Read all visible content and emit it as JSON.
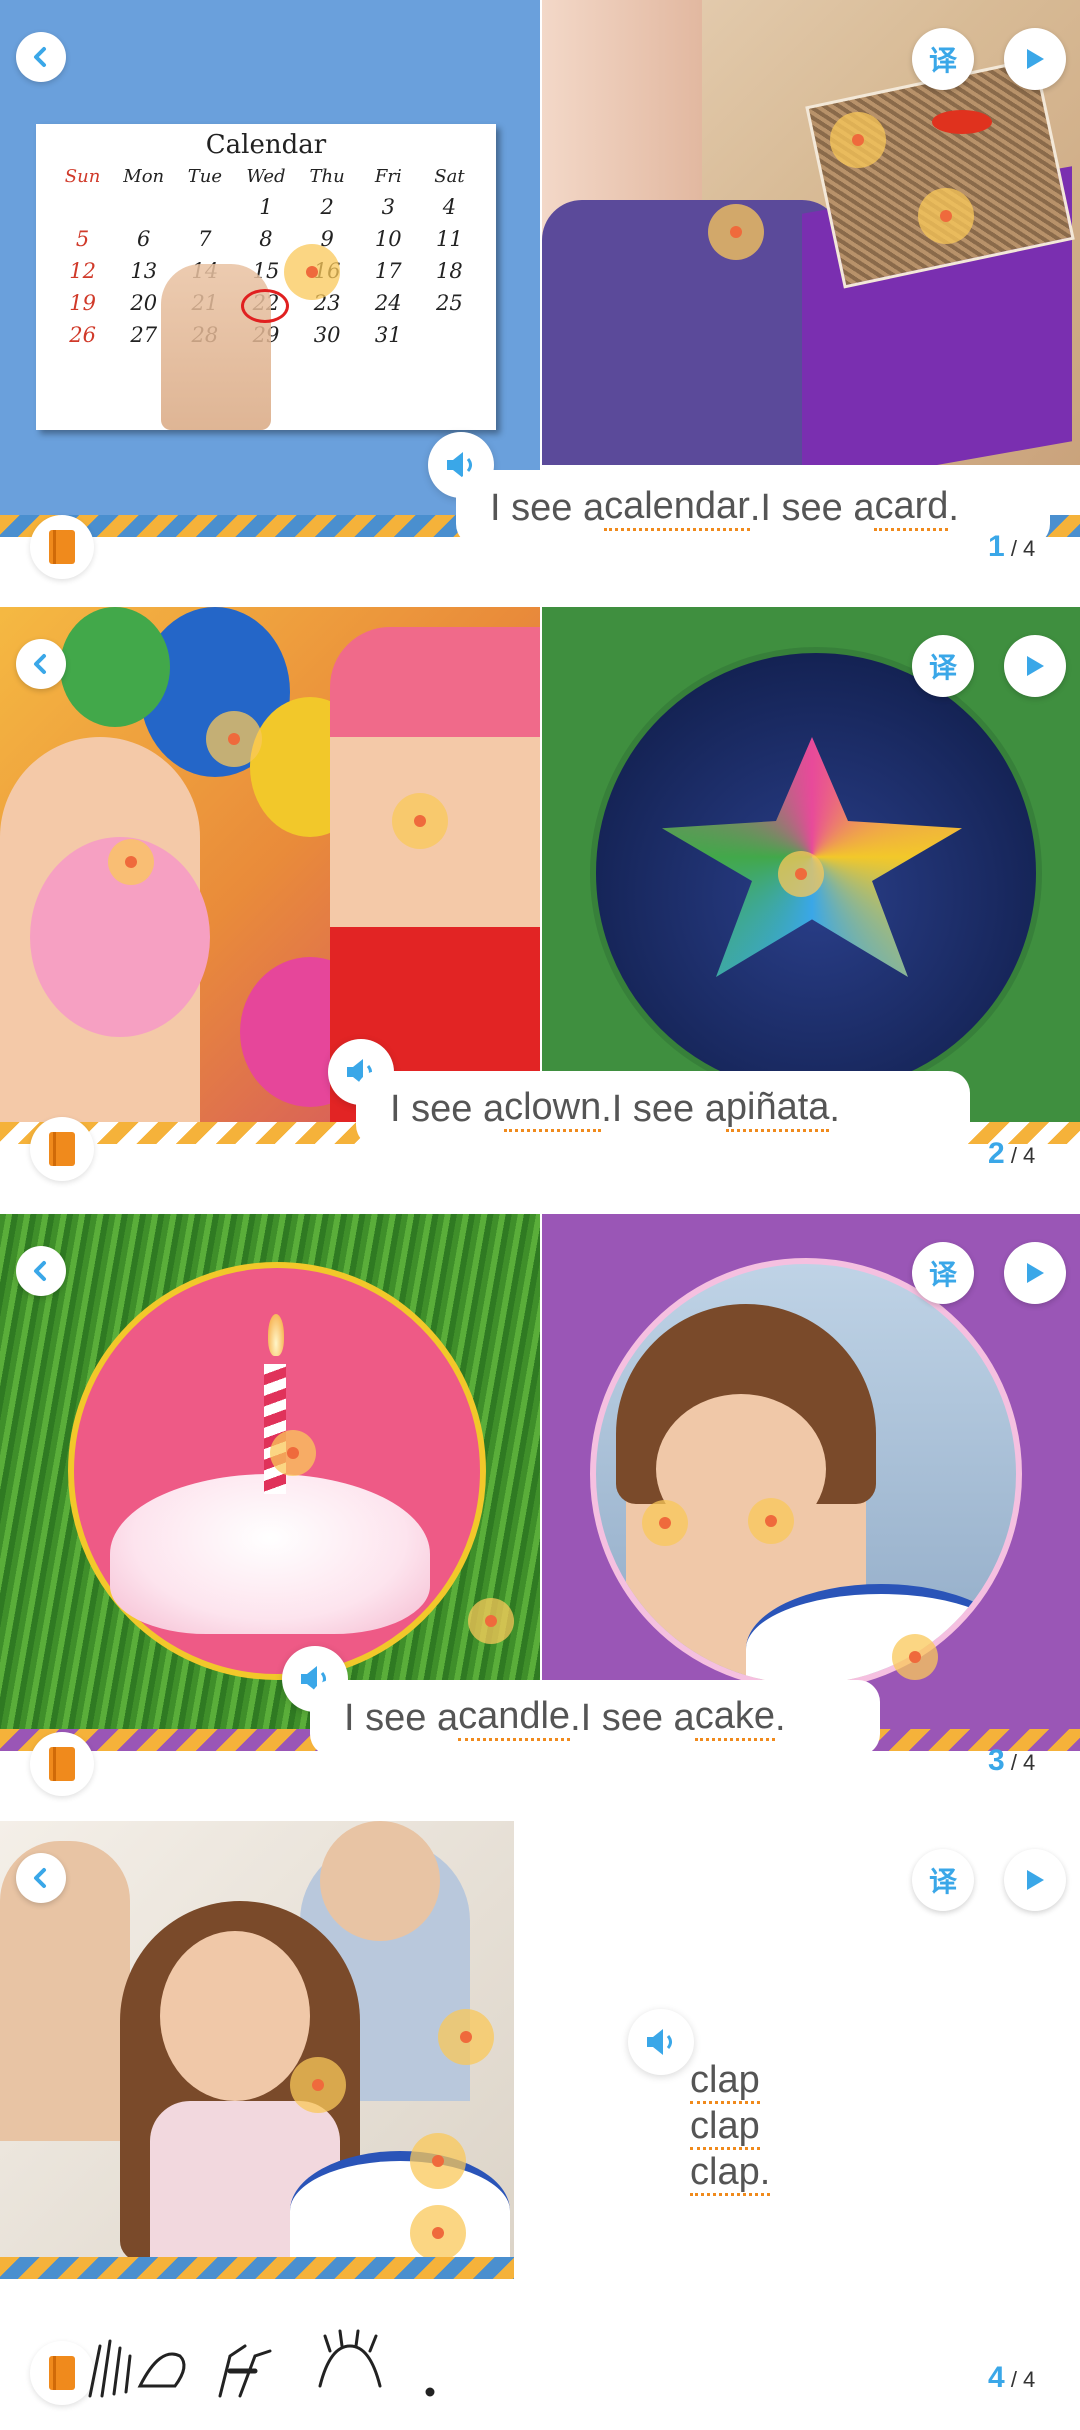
{
  "pages": [
    {
      "sentence_parts": [
        "I see a ",
        "calendar",
        ".I see a ",
        "card",
        "."
      ],
      "page_current": "1",
      "page_total": "/ 4",
      "calendar": {
        "title": "Calendar",
        "days": [
          "Sun",
          "Mon",
          "Tue",
          "Wed",
          "Thu",
          "Fri",
          "Sat"
        ],
        "rows": [
          [
            "",
            "",
            "",
            "1",
            "2",
            "3",
            "4"
          ],
          [
            "5",
            "6",
            "7",
            "8",
            "9",
            "10",
            "11"
          ],
          [
            "12",
            "13",
            "14",
            "15",
            "16",
            "17",
            "18"
          ],
          [
            "19",
            "20",
            "21",
            "22",
            "23",
            "24",
            "25"
          ],
          [
            "26",
            "27",
            "28",
            "29",
            "30",
            "31",
            ""
          ]
        ]
      }
    },
    {
      "sentence_parts": [
        "I see a ",
        "clown",
        ".I see a ",
        "piñata",
        "."
      ],
      "page_current": "2",
      "page_total": "/ 4"
    },
    {
      "sentence_parts": [
        "I see a ",
        "candle",
        ".I see a ",
        "cake",
        "."
      ],
      "page_current": "3",
      "page_total": "/ 4"
    },
    {
      "lines": [
        "clap",
        "clap",
        "clap."
      ],
      "page_current": "4",
      "page_total": "/ 4"
    }
  ],
  "buttons": {
    "translate_label": "译",
    "back_icon": "back-icon",
    "play_icon": "play-icon",
    "speaker_icon": "speaker-icon",
    "book_icon": "book-icon"
  },
  "colors": {
    "accent_blue": "#3aa7e8",
    "accent_orange": "#f08a1c",
    "page1_bg": "#5b9bd5",
    "page2_bg": "#3f8f3f",
    "page3_bg": "#9a56b6"
  }
}
